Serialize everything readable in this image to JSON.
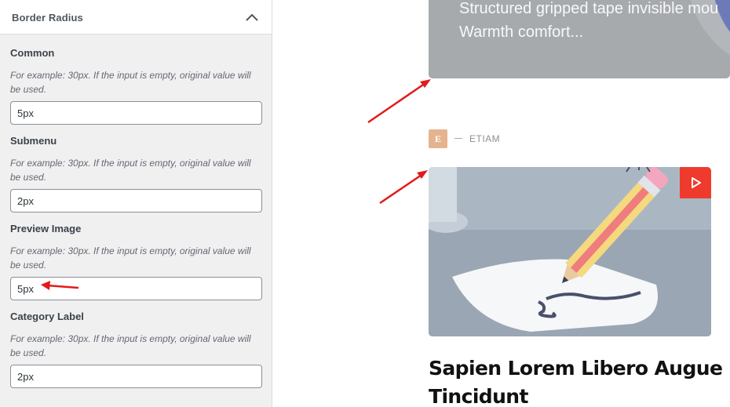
{
  "panel": {
    "title": "Border Radius",
    "fields": [
      {
        "label": "Common",
        "description": "For example: 30px. If the input is empty, original value will be used.",
        "value": "5px"
      },
      {
        "label": "Submenu",
        "description": "For example: 30px. If the input is empty, original value will be used.",
        "value": "2px"
      },
      {
        "label": "Preview Image",
        "description": "For example: 30px. If the input is empty, original value will be used.",
        "value": "5px"
      },
      {
        "label": "Category Label",
        "description": "For example: 30px. If the input is empty, original value will be used.",
        "value": "2px"
      }
    ]
  },
  "preview": {
    "excerpt_line1": "Structured gripped tape invisible mou",
    "excerpt_line2": "Warmth comfort...",
    "category_badge": "E",
    "category_name": "ETIAM",
    "post_title": "Sapien Lorem Libero Augue Tincidunt",
    "play_icon": "play-icon"
  },
  "colors": {
    "annotation_arrow": "#e21b1b",
    "play_button": "#ef3b2d",
    "category_badge": "#e5b48f"
  }
}
